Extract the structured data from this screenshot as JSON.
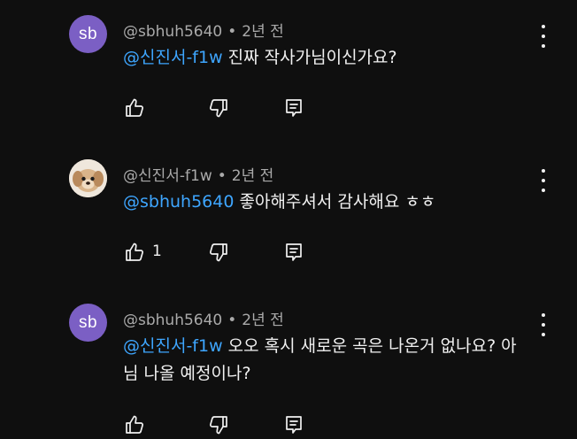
{
  "comments": [
    {
      "avatar_text": "sb",
      "author": "@sbhuh5640",
      "separator": "•",
      "time": "2년 전",
      "mention": "@신진서-f1w",
      "body": " 진짜 작사가님이신가요?",
      "like_count": ""
    },
    {
      "avatar_text": "",
      "author": "@신진서-f1w",
      "separator": "•",
      "time": "2년 전",
      "mention": "@sbhuh5640",
      "body": " 좋아해주셔서 감사해요 ㅎㅎ",
      "like_count": "1"
    },
    {
      "avatar_text": "sb",
      "author": "@sbhuh5640",
      "separator": "•",
      "time": "2년 전",
      "mention": "@신진서-f1w",
      "body": " 오오 혹시 새로운 곡은 나온거 없나요? 아님 나올 예정이나?",
      "like_count": ""
    }
  ],
  "icons": {
    "like": "thumb-up-icon",
    "dislike": "thumb-down-icon",
    "reply": "reply-icon",
    "menu": "more-vertical-icon"
  },
  "colors": {
    "background": "#0f0f0f",
    "mention": "#3ea6ff",
    "avatar_sb": "#7b5fc4",
    "meta_text": "#aaaaaa"
  }
}
